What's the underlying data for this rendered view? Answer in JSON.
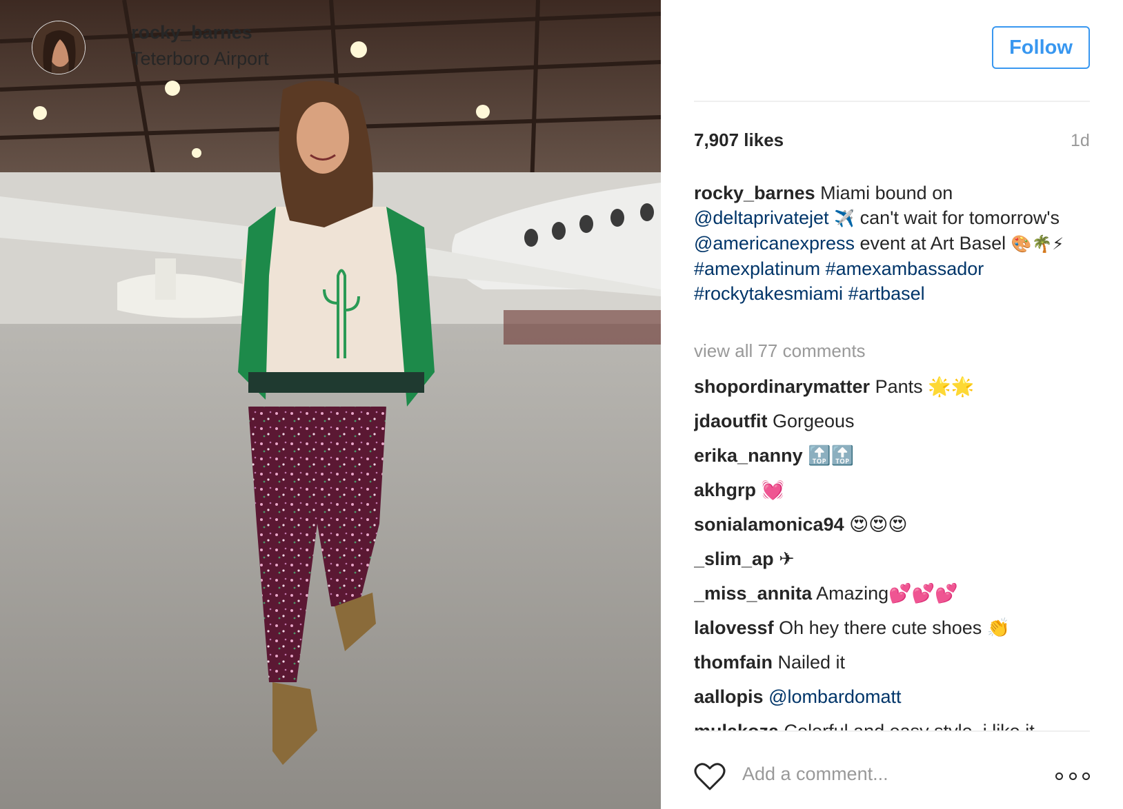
{
  "post": {
    "username": "rocky_barnes",
    "location": "Teterboro Airport",
    "follow_label": "Follow",
    "likes": "7,907 likes",
    "time": "1d"
  },
  "caption": {
    "username": "rocky_barnes",
    "text1": " Miami bound on ",
    "mention1": "@deltaprivatejet",
    "emoji1": " ✈️ ",
    "text2": " can't wait for tomorrow's ",
    "mention2": "@americanexpress",
    "text3": " event at Art Basel ",
    "emoji2": "🎨🌴⚡",
    "tag1": "#amexplatinum",
    "tag2": "#amexambassador",
    "tag3": "#rockytakesmiami",
    "tag4": "#artbasel"
  },
  "view_all": "view all 77 comments",
  "comments": [
    {
      "user": "shopordinarymatter",
      "text": " Pants 🌟🌟"
    },
    {
      "user": "jdaoutfit",
      "text": " Gorgeous"
    },
    {
      "user": "erika_nanny",
      "text": " 🔝🔝"
    },
    {
      "user": "akhgrp",
      "text": " 💓"
    },
    {
      "user": "sonialamonica94",
      "text": " 😍😍😍"
    },
    {
      "user": "_slim_ap",
      "text": " ✈"
    },
    {
      "user": "_miss_annita",
      "text": " Amazing💕💕💕"
    },
    {
      "user": "lalovessf",
      "text": " Oh hey there cute shoes 👏"
    },
    {
      "user": "thomfain",
      "text": " Nailed it"
    },
    {
      "user": "aallopis",
      "mention": "@lombardomatt"
    },
    {
      "user": "mulakoza",
      "text": " Colorful and easy style, i like it"
    }
  ],
  "add_comment_placeholder": "Add a comment...",
  "icons": {
    "heart": "heart-icon",
    "more": "more-options-icon",
    "avatar": "avatar"
  },
  "colors": {
    "follow_blue": "#3897f0",
    "link_navy": "#003569",
    "muted_gray": "#999999"
  }
}
